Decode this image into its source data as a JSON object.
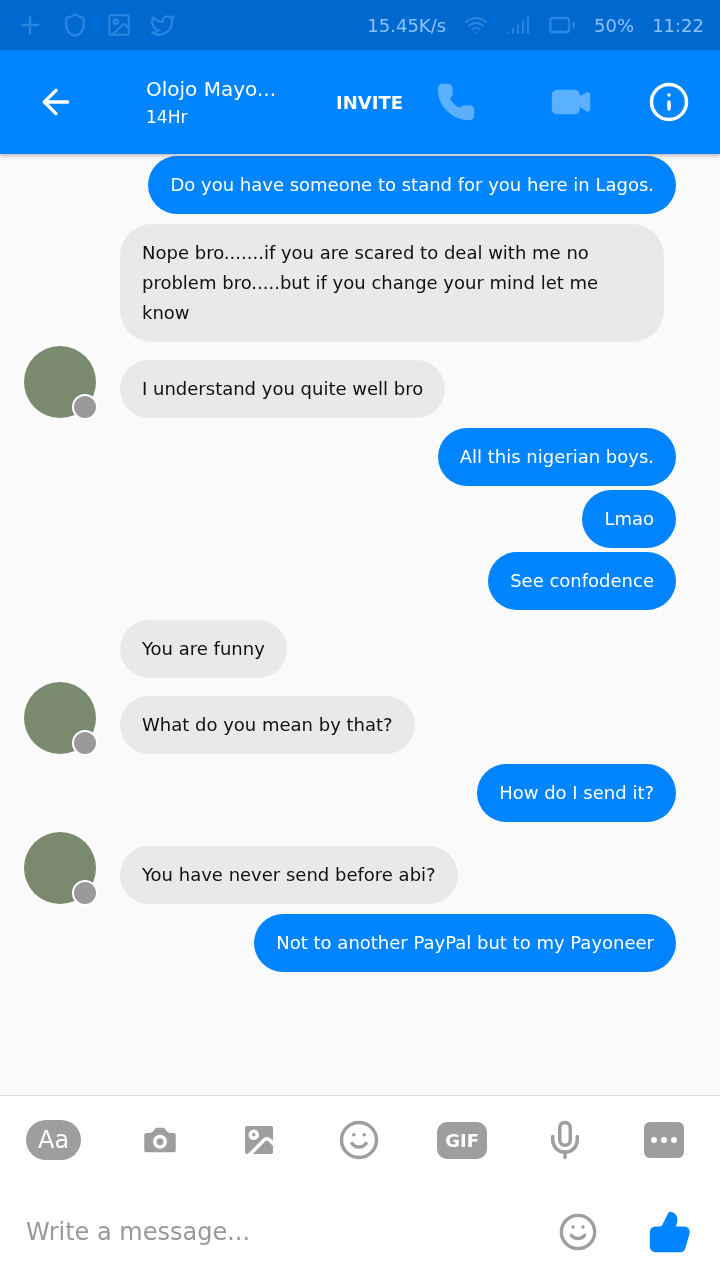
{
  "status_bar": {
    "speed": "15.45K/s",
    "battery": "50%",
    "time": "11:22"
  },
  "header": {
    "name": "Olojo Mayo...",
    "status": "14Hr",
    "invite": "INVITE"
  },
  "messages": [
    {
      "kind": "outgoing",
      "text": "Do you have someone to stand for you here in Lagos."
    },
    {
      "kind": "incoming",
      "text": "Nope bro.......if you are scared to deal with me no problem bro.....but if you change your mind let me know",
      "avatar": false
    },
    {
      "kind": "incoming",
      "text": "I understand you quite well bro",
      "avatar": true
    },
    {
      "kind": "outgoing",
      "text": "All this nigerian boys."
    },
    {
      "kind": "outgoing",
      "text": "Lmao"
    },
    {
      "kind": "outgoing",
      "text": "See confodence"
    },
    {
      "kind": "incoming",
      "text": "You are funny",
      "avatar": false
    },
    {
      "kind": "incoming",
      "text": "What do you mean by that?",
      "avatar": true
    },
    {
      "kind": "outgoing",
      "text": "How do I send it?"
    },
    {
      "kind": "incoming",
      "text": "You have never send before abi?",
      "avatar": true
    },
    {
      "kind": "outgoing",
      "text": "Not to another PayPal but to my Payoneer"
    }
  ],
  "composer": {
    "aa": "Aa",
    "gif": "GIF",
    "placeholder": "Write a message..."
  }
}
